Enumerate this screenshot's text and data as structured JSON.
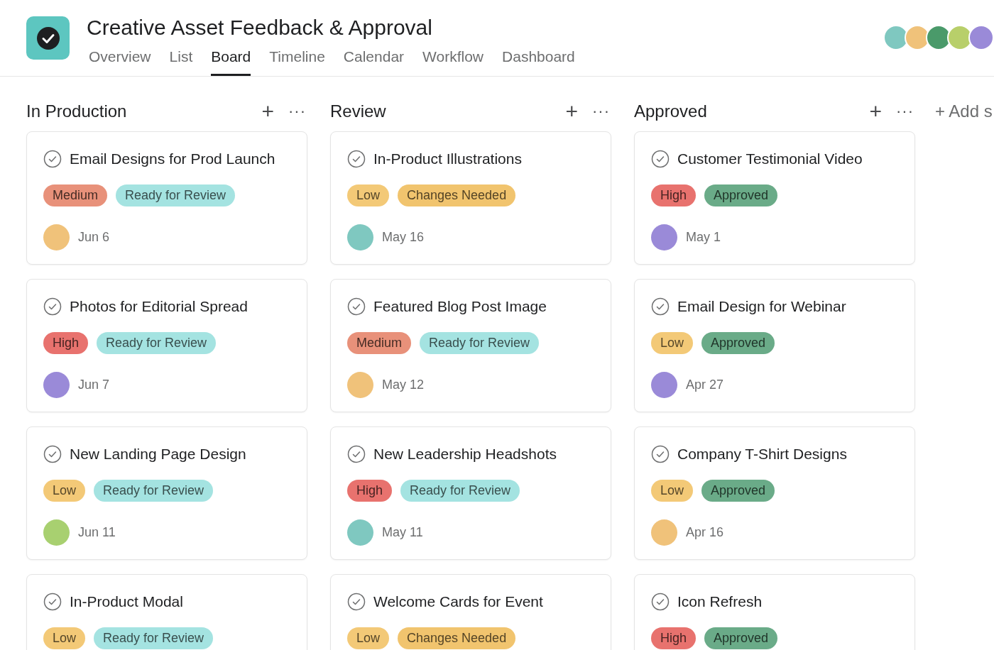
{
  "project": {
    "title": "Creative Asset Feedback & Approval"
  },
  "tabs": [
    {
      "label": "Overview",
      "selected": false
    },
    {
      "label": "List",
      "selected": false
    },
    {
      "label": "Board",
      "selected": true
    },
    {
      "label": "Timeline",
      "selected": false
    },
    {
      "label": "Calendar",
      "selected": false
    },
    {
      "label": "Workflow",
      "selected": false
    },
    {
      "label": "Dashboard",
      "selected": false
    }
  ],
  "members": [
    {
      "color": "#7fc8c0"
    },
    {
      "color": "#f0c27a"
    },
    {
      "color": "#4a9a6a"
    },
    {
      "color": "#b8cf6a"
    },
    {
      "color": "#9a8ad8"
    }
  ],
  "columns": [
    {
      "title": "In Production",
      "add": "+",
      "more": "···",
      "cards": [
        {
          "title": "Email Designs for Prod Launch",
          "tags": [
            {
              "label": "Medium",
              "color": "#e8917a"
            },
            {
              "label": "Ready for Review",
              "color": "#a4e3e1"
            }
          ],
          "assignee": {
            "color": "#f0c27a"
          },
          "due": "Jun 6"
        },
        {
          "title": "Photos for Editorial Spread",
          "tags": [
            {
              "label": "High",
              "color": "#e8726e"
            },
            {
              "label": "Ready for Review",
              "color": "#a4e3e1"
            }
          ],
          "assignee": {
            "color": "#9a8ad8"
          },
          "due": "Jun 7"
        },
        {
          "title": "New Landing Page Design",
          "tags": [
            {
              "label": "Low",
              "color": "#f3c977"
            },
            {
              "label": "Ready for Review",
              "color": "#a4e3e1"
            }
          ],
          "assignee": {
            "color": "#a8d070"
          },
          "due": "Jun 11"
        },
        {
          "title": "In-Product Modal",
          "tags": [
            {
              "label": "Low",
              "color": "#f3c977"
            },
            {
              "label": "Ready for Review",
              "color": "#a4e3e1"
            }
          ]
        }
      ]
    },
    {
      "title": "Review",
      "add": "+",
      "more": "···",
      "cards": [
        {
          "title": "In-Product Illustrations",
          "tags": [
            {
              "label": "Low",
              "color": "#f3c977"
            },
            {
              "label": "Changes Needed",
              "color": "#f1c46e"
            }
          ],
          "assignee": {
            "color": "#7fc8c0"
          },
          "due": "May 16"
        },
        {
          "title": "Featured Blog Post Image",
          "tags": [
            {
              "label": "Medium",
              "color": "#e8917a"
            },
            {
              "label": "Ready for Review",
              "color": "#a4e3e1"
            }
          ],
          "assignee": {
            "color": "#f0c27a"
          },
          "due": "May 12"
        },
        {
          "title": "New Leadership Headshots",
          "tags": [
            {
              "label": "High",
              "color": "#e8726e"
            },
            {
              "label": "Ready for Review",
              "color": "#a4e3e1"
            }
          ],
          "assignee": {
            "color": "#7fc8c0"
          },
          "due": "May 11"
        },
        {
          "title": "Welcome Cards for Event",
          "tags": [
            {
              "label": "Low",
              "color": "#f3c977"
            },
            {
              "label": "Changes Needed",
              "color": "#f1c46e"
            }
          ]
        }
      ]
    },
    {
      "title": "Approved",
      "add": "+",
      "more": "···",
      "cards": [
        {
          "title": "Customer Testimonial Video",
          "tags": [
            {
              "label": "High",
              "color": "#e8726e"
            },
            {
              "label": "Approved",
              "color": "#6aab88"
            }
          ],
          "assignee": {
            "color": "#9a8ad8"
          },
          "due": "May 1"
        },
        {
          "title": "Email Design for Webinar",
          "tags": [
            {
              "label": "Low",
              "color": "#f3c977"
            },
            {
              "label": "Approved",
              "color": "#6aab88"
            }
          ],
          "assignee": {
            "color": "#9a8ad8"
          },
          "due": "Apr 27"
        },
        {
          "title": "Company T-Shirt Designs",
          "tags": [
            {
              "label": "Low",
              "color": "#f3c977"
            },
            {
              "label": "Approved",
              "color": "#6aab88"
            }
          ],
          "assignee": {
            "color": "#f0c27a"
          },
          "due": "Apr 16"
        },
        {
          "title": "Icon Refresh",
          "tags": [
            {
              "label": "High",
              "color": "#e8726e"
            },
            {
              "label": "Approved",
              "color": "#6aab88"
            }
          ]
        }
      ]
    }
  ],
  "add_section": "+ Add s"
}
